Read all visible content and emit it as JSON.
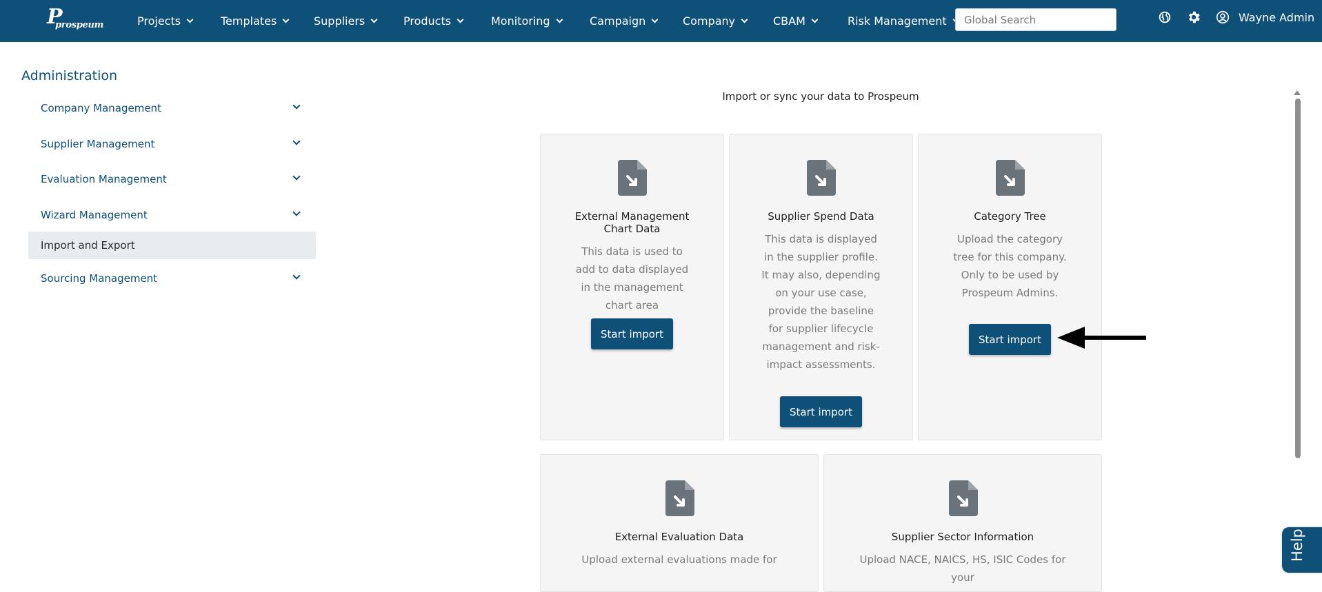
{
  "header": {
    "logo_text": "prospeum",
    "logo_mark": "P",
    "nav": [
      {
        "label": "Projects"
      },
      {
        "label": "Templates"
      },
      {
        "label": "Suppliers"
      },
      {
        "label": "Products"
      },
      {
        "label": "Monitoring"
      },
      {
        "label": "Campaign"
      },
      {
        "label": "Company"
      },
      {
        "label": "CBAM"
      },
      {
        "label": "Risk Management"
      }
    ],
    "search": {
      "placeholder": "Global Search",
      "value": ""
    },
    "icons": [
      "globe-icon",
      "gear-icon",
      "user-circle-icon"
    ],
    "user_name": "Wayne Admin"
  },
  "sidebar": {
    "title": "Administration",
    "items": [
      {
        "label": "Company Management",
        "expandable": true
      },
      {
        "label": "Supplier Management",
        "expandable": true
      },
      {
        "label": "Evaluation Management",
        "expandable": true
      },
      {
        "label": "Wizard Management",
        "expandable": true
      },
      {
        "label": "Import and Export",
        "expandable": false,
        "active": true
      },
      {
        "label": "Sourcing Management",
        "expandable": true
      }
    ]
  },
  "main": {
    "heading": "Import or sync your data to Prospeum",
    "cards": [
      {
        "title": "External Management Chart Data",
        "description": "This data is used to add to data displayed in the management chart area",
        "button_label": "Start import"
      },
      {
        "title": "Supplier Spend Data",
        "description": "This data is displayed in the supplier profile. It may also, depending on your use case, provide the baseline for supplier lifecycle management and risk-impact assessments.",
        "button_label": "Start import"
      },
      {
        "title": "Category Tree",
        "description": "Upload the category tree for this company. Only to be used by Prospeum Admins.",
        "button_label": "Start import"
      },
      {
        "title": "External Evaluation Data",
        "description": "Upload external evaluations made for"
      },
      {
        "title": "Supplier Sector Information",
        "description": "Upload NACE, NAICS, HS, ISIC Codes for your"
      }
    ]
  },
  "help": {
    "label": "Help"
  },
  "colors": {
    "brand": "#0f5078",
    "card_bg": "#f5f5f5",
    "active_item_bg": "#e8ecef"
  }
}
